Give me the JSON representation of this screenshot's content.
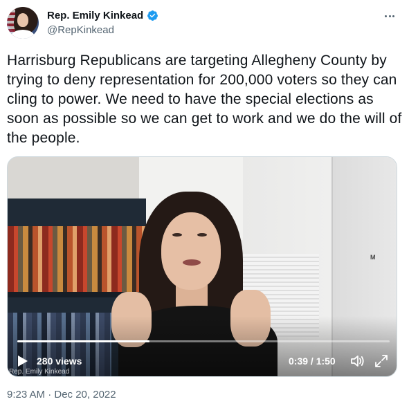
{
  "author": {
    "display_name": "Rep. Emily Kinkead",
    "handle": "@RepKinkead",
    "verified": true
  },
  "tweet": {
    "text": "Harrisburg Republicans are targeting Allegheny County by trying to deny representation for 200,000 voters so they can cling to power. We need to have the special elections as soon as possible so we can get to work and we do the will of the people.",
    "timestamp": "9:23 AM · Dec 20, 2022"
  },
  "video": {
    "views": "280 views",
    "time": "0:39 / 1:50",
    "progress": 0.355,
    "watermark": "Rep. Emily Kinkead",
    "door_mark": "M"
  },
  "icons": {
    "verified": "verified-badge-icon",
    "more": "more-options-icon",
    "play": "play-icon",
    "volume": "volume-icon",
    "fullscreen": "fullscreen-icon"
  },
  "colors": {
    "verified_blue": "#1d9bf0",
    "secondary_text": "#536471",
    "primary_text": "#0f1419"
  }
}
